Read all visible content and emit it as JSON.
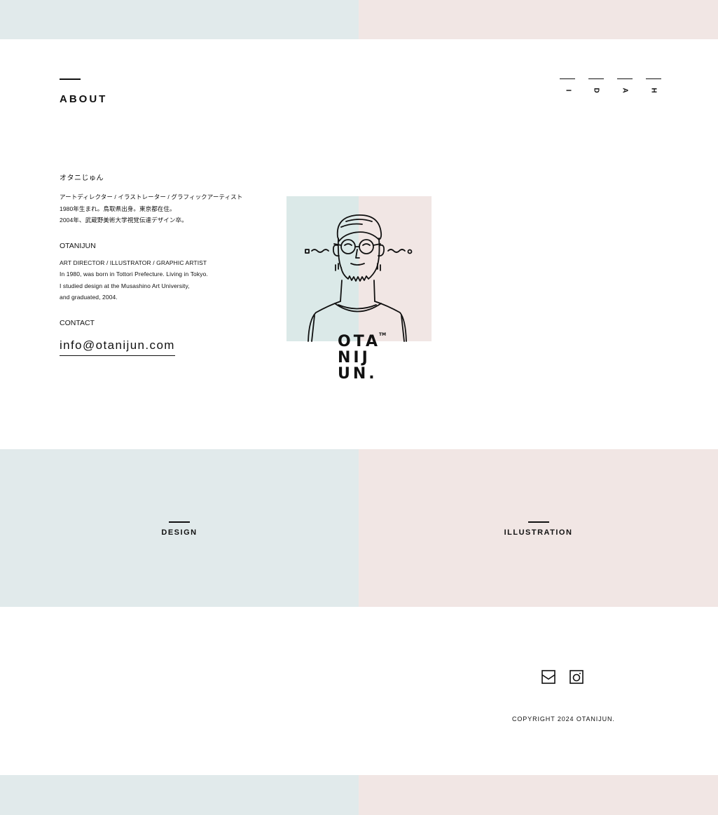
{
  "section": {
    "title": "ABOUT"
  },
  "side_nav": [
    {
      "letter": "I"
    },
    {
      "letter": "D"
    },
    {
      "letter": "A"
    },
    {
      "letter": "H"
    }
  ],
  "profile": {
    "ja": {
      "name": "オタニじゅん",
      "lines": [
        "アートディレクター / イラストレーター / グラフィックアーティスト",
        "1980年生まれ。鳥取県出身。東京都在住。",
        "2004年、武蔵野美術大学視覚伝達デザイン卒。"
      ]
    },
    "en": {
      "name": "OTANIJUN",
      "lines": [
        "ART DIRECTOR / ILLUSTRATOR / GRAPHIC ARTIST",
        "In 1980, was born in Tottori Prefecture. Living in Tokyo.",
        "I studied design at the Musashino Art University,",
        "and graduated, 2004."
      ]
    },
    "contact_label": "CONTACT",
    "email": "info@otanijun.com"
  },
  "logo": {
    "lines": [
      "OTA",
      "NIJ",
      "UN."
    ],
    "trademark": "TM"
  },
  "categories": {
    "design": "DESIGN",
    "illustration": "ILLUSTRATION"
  },
  "footer": {
    "icons": [
      "mail-icon",
      "instagram-icon"
    ],
    "copyright": "COPYRIGHT 2024 OTANIJUN."
  },
  "colors": {
    "blue_panel": "#e1eaeb",
    "pink_panel": "#f1e6e4",
    "ink": "#111111"
  }
}
